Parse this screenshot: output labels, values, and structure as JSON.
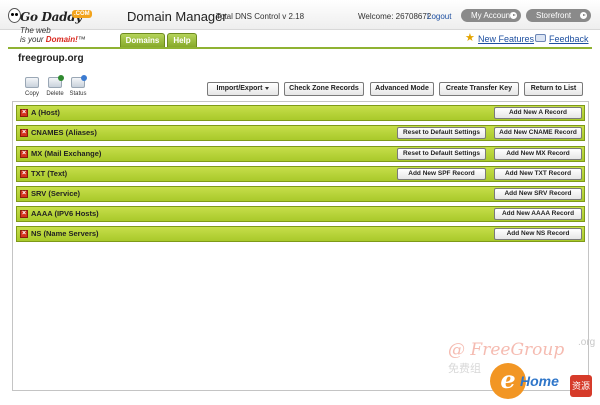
{
  "header": {
    "logo": {
      "brand": "Go Daddy",
      "com": ".COM",
      "tagline_1": "The web",
      "tagline_2_prefix": "is your ",
      "tagline_2_emph": "Domain!",
      "tm": "™"
    },
    "title": "Domain Manager",
    "version": "Total DNS Control v 2.18",
    "welcome": "Welcome: 26708672",
    "logout": "Logout",
    "my_account": "My Account",
    "storefront": "Storefront",
    "tabs": [
      {
        "label": "Domains"
      },
      {
        "label": "Help"
      }
    ],
    "new_features": "New Features",
    "feedback": "Feedback"
  },
  "domain": "freegroup.org",
  "toolbar": {
    "icons": [
      {
        "label": "Copy"
      },
      {
        "label": "Delete"
      },
      {
        "label": "Status"
      }
    ],
    "buttons": {
      "import_export": "Import/Export",
      "check_zone": "Check Zone Records",
      "advanced": "Advanced Mode",
      "transfer": "Create Transfer Key",
      "return": "Return to List"
    }
  },
  "records": [
    {
      "label": "A (Host)",
      "add": "Add New A Record"
    },
    {
      "label": "CNAMES (Aliases)",
      "reset": "Reset to Default Settings",
      "add": "Add New CNAME Record"
    },
    {
      "label": "MX (Mail Exchange)",
      "reset": "Reset to Default Settings",
      "add": "Add New MX Record"
    },
    {
      "label": "TXT (Text)",
      "spf": "Add New SPF Record",
      "add": "Add New TXT Record"
    },
    {
      "label": "SRV (Service)",
      "add": "Add New SRV Record"
    },
    {
      "label": "AAAA (IPV6 Hosts)",
      "add": "Add New AAAA Record"
    },
    {
      "label": "NS (Name Servers)",
      "add": "Add New NS Record"
    }
  ],
  "toggle_glyph": "×",
  "watermark": {
    "text": "@ FreeGroup",
    "org": ".org",
    "cn": "免费组",
    "e": "e",
    "home": "Home",
    "net": "资源网"
  },
  "colors": {
    "record_bar": "#b8d33a",
    "tab": "#9bbd3a",
    "link": "#1d4fa0",
    "toggle": "#d4331e"
  }
}
